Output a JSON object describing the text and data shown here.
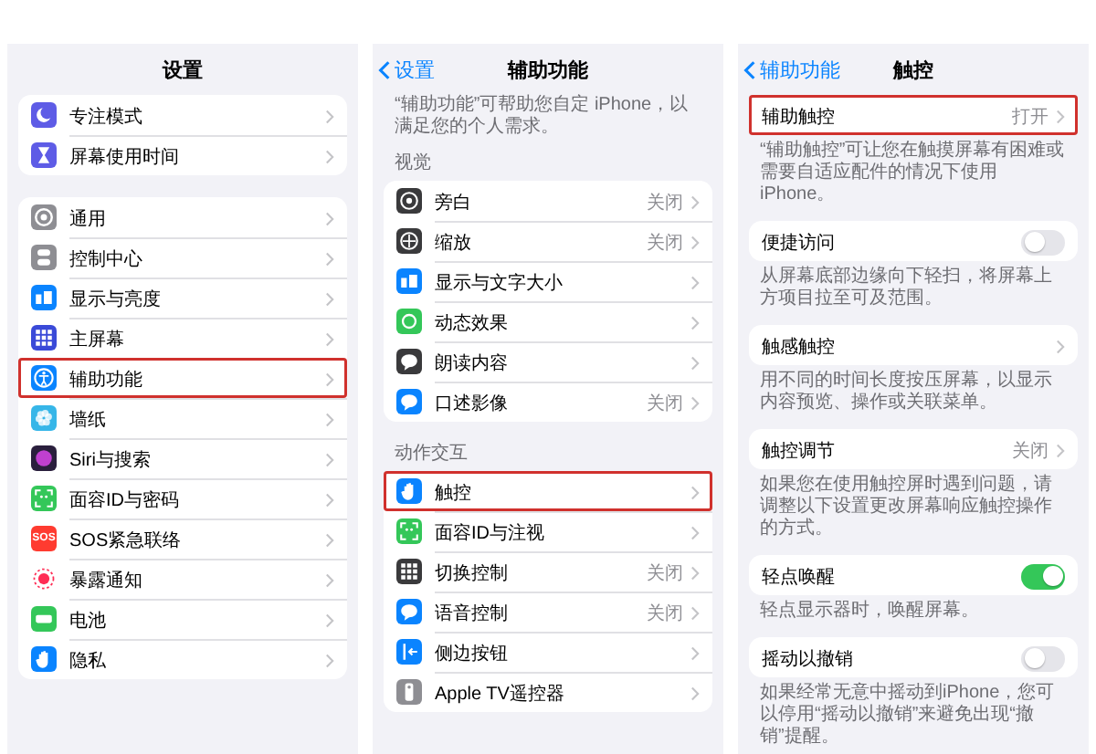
{
  "panels": [
    {
      "nav": {
        "title": "设置"
      },
      "sections": [
        {
          "rows": [
            {
              "kind": "link",
              "icon": {
                "kind": "moon",
                "color": "#5e5ce6"
              },
              "label": "专注模式",
              "highlighted": false
            },
            {
              "kind": "link",
              "icon": {
                "kind": "hourglass",
                "color": "#5e5ce6"
              },
              "label": "屏幕使用时间",
              "highlighted": false
            }
          ]
        },
        {
          "rows": [
            {
              "kind": "link",
              "icon": {
                "kind": "gear",
                "color": "#8e8e93"
              },
              "label": "通用",
              "highlighted": false
            },
            {
              "kind": "link",
              "icon": {
                "kind": "toggles",
                "color": "#8e8e93"
              },
              "label": "控制中心",
              "highlighted": false
            },
            {
              "kind": "link",
              "icon": {
                "kind": "text-size",
                "color": "#0a84ff"
              },
              "label": "显示与亮度",
              "highlighted": false
            },
            {
              "kind": "link",
              "icon": {
                "kind": "grid",
                "color": "#3a4ad8"
              },
              "label": "主屏幕",
              "highlighted": false
            },
            {
              "kind": "link",
              "icon": {
                "kind": "person",
                "color": "#0a84ff"
              },
              "label": "辅助功能",
              "highlighted": true
            },
            {
              "kind": "link",
              "icon": {
                "kind": "flower",
                "color": "#36b6e8"
              },
              "label": "墙纸",
              "highlighted": false
            },
            {
              "kind": "link",
              "icon": {
                "kind": "orb",
                "color": "#2a1f3d"
              },
              "label": "Siri与搜索",
              "highlighted": false
            },
            {
              "kind": "link",
              "icon": {
                "kind": "face",
                "color": "#34c759"
              },
              "label": "面容ID与密码",
              "highlighted": false
            },
            {
              "kind": "link",
              "icon": {
                "kind": "label",
                "color": "#ff3b30",
                "text": "SOS"
              },
              "label": "SOS紧急联络",
              "highlighted": false
            },
            {
              "kind": "link",
              "icon": {
                "kind": "dots",
                "color": "#ff2d55"
              },
              "label": "暴露通知",
              "highlighted": false
            },
            {
              "kind": "link",
              "icon": {
                "kind": "battery",
                "color": "#34c759"
              },
              "label": "电池",
              "highlighted": false
            },
            {
              "kind": "link",
              "icon": {
                "kind": "hand",
                "color": "#0a84ff"
              },
              "label": "隐私",
              "highlighted": false
            }
          ]
        }
      ]
    },
    {
      "nav": {
        "back": "设置",
        "title": "辅助功能"
      },
      "intro": "“辅助功能”可帮助您自定 iPhone，以满足您的个人需求。",
      "sections": [
        {
          "header": "视觉",
          "rows": [
            {
              "kind": "link",
              "icon": {
                "kind": "speaker",
                "color": "#3a3a3c"
              },
              "label": "旁白",
              "value": "关闭",
              "highlighted": false
            },
            {
              "kind": "link",
              "icon": {
                "kind": "zoom",
                "color": "#3a3a3c"
              },
              "label": "缩放",
              "value": "关闭",
              "highlighted": false
            },
            {
              "kind": "link",
              "icon": {
                "kind": "text-size",
                "color": "#0a84ff"
              },
              "label": "显示与文字大小",
              "highlighted": false
            },
            {
              "kind": "link",
              "icon": {
                "kind": "motion",
                "color": "#34c759"
              },
              "label": "动态效果",
              "highlighted": false
            },
            {
              "kind": "link",
              "icon": {
                "kind": "speech",
                "color": "#3a3a3c"
              },
              "label": "朗读内容",
              "highlighted": false
            },
            {
              "kind": "link",
              "icon": {
                "kind": "speech",
                "color": "#0a84ff"
              },
              "label": "口述影像",
              "value": "关闭",
              "highlighted": false
            }
          ]
        },
        {
          "header": "动作交互",
          "rows": [
            {
              "kind": "link",
              "icon": {
                "kind": "hand",
                "color": "#0a84ff"
              },
              "label": "触控",
              "highlighted": true
            },
            {
              "kind": "link",
              "icon": {
                "kind": "face",
                "color": "#34c759"
              },
              "label": "面容ID与注视",
              "highlighted": false
            },
            {
              "kind": "link",
              "icon": {
                "kind": "grid",
                "color": "#3a3a3c"
              },
              "label": "切换控制",
              "value": "关闭",
              "highlighted": false
            },
            {
              "kind": "link",
              "icon": {
                "kind": "speech",
                "color": "#0a84ff"
              },
              "label": "语音控制",
              "value": "关闭",
              "highlighted": false
            },
            {
              "kind": "link",
              "icon": {
                "kind": "side",
                "color": "#0a84ff"
              },
              "label": "侧边按钮",
              "highlighted": false
            },
            {
              "kind": "link",
              "icon": {
                "kind": "remote",
                "color": "#8e8e93"
              },
              "label": "Apple TV遥控器",
              "highlighted": false
            }
          ]
        }
      ]
    },
    {
      "nav": {
        "back": "辅助功能",
        "title": "触控"
      },
      "sections": [
        {
          "rows": [
            {
              "kind": "link",
              "label": "辅助触控",
              "value": "打开",
              "highlighted": true
            }
          ],
          "footer": "“辅助触控”可让您在触摸屏幕有困难或需要自适应配件的情况下使用iPhone。"
        },
        {
          "rows": [
            {
              "kind": "toggle",
              "label": "便捷访问",
              "on": false,
              "highlighted": false
            }
          ],
          "footer": "从屏幕底部边缘向下轻扫，将屏幕上方项目拉至可及范围。"
        },
        {
          "rows": [
            {
              "kind": "link",
              "label": "触感触控",
              "highlighted": false
            }
          ],
          "footer": "用不同的时间长度按压屏幕，以显示内容预览、操作或关联菜单。"
        },
        {
          "rows": [
            {
              "kind": "link",
              "label": "触控调节",
              "value": "关闭",
              "highlighted": false
            }
          ],
          "footer": "如果您在使用触控屏时遇到问题，请调整以下设置更改屏幕响应触控操作的方式。"
        },
        {
          "rows": [
            {
              "kind": "toggle",
              "label": "轻点唤醒",
              "on": true,
              "highlighted": false
            }
          ],
          "footer": "轻点显示器时，唤醒屏幕。"
        },
        {
          "rows": [
            {
              "kind": "toggle",
              "label": "摇动以撤销",
              "on": false,
              "highlighted": false
            }
          ],
          "footer": "如果经常无意中摇动到iPhone，您可以停用“摇动以撤销”来避免出现“撤销”提醒。"
        }
      ]
    }
  ]
}
